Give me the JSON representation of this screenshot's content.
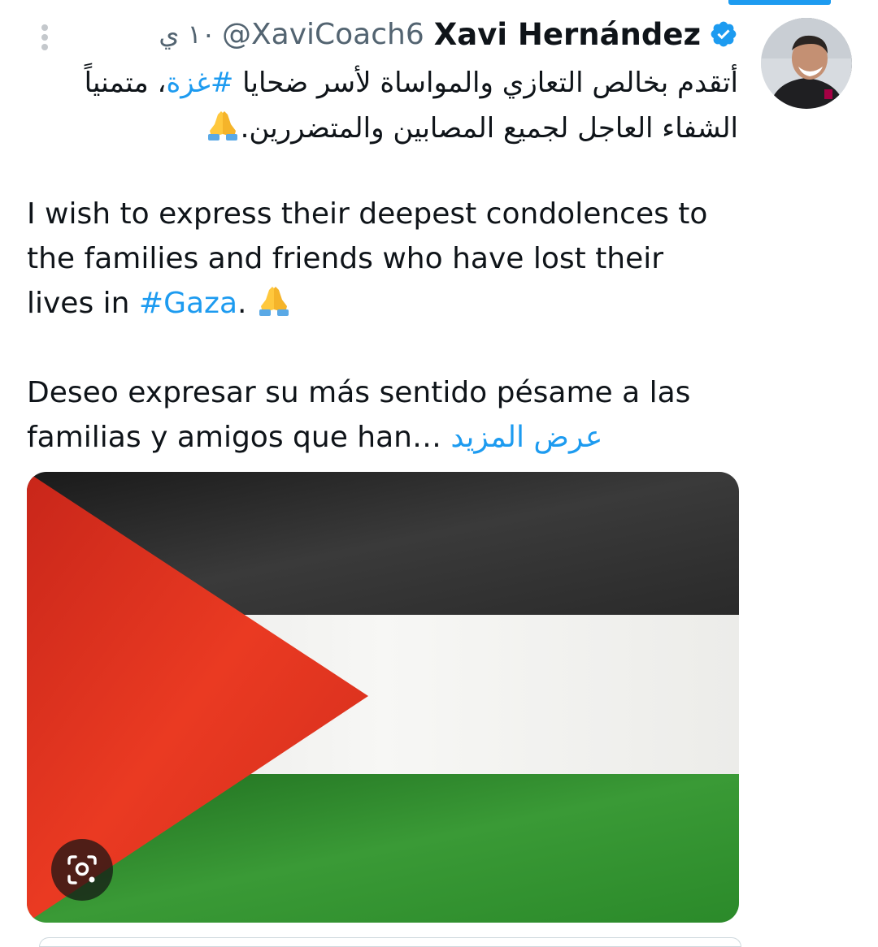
{
  "tweet": {
    "time": "١٠ ي",
    "handle": "@XaviCoach6",
    "display_name": "Xavi Hernández",
    "arabic": {
      "line1_before": "أتقدم بخالص التعازي والمواساة لأسر ضحايا ",
      "hashtag": "#غزة",
      "line1_after": "، متمنياً",
      "line2": "الشفاء العاجل لجميع المصابين والمتضررين."
    },
    "english": {
      "line1": "I wish to express their deepest condolences to",
      "line2": "the families and friends who have lost their",
      "line3_before": "lives in ",
      "hashtag": "#Gaza",
      "line3_after": ". "
    },
    "spanish": {
      "line1": "Deseo expresar su más sentido pésame a las",
      "line2": "familias y amigos que han… ",
      "show_more": "عرض المزيد"
    }
  },
  "icons": {
    "more": "more-vertical-icon",
    "verified": "verified-badge-icon",
    "emoji": "folded-hands-emoji",
    "lens": "image-search-lens-icon"
  },
  "media": {
    "type": "flag image",
    "colors": {
      "black": "#2a2a2a",
      "white": "#f2f2f0",
      "green": "#2e8a2c",
      "red": "#e2311e"
    }
  },
  "colors": {
    "accent": "#1d9bf0",
    "text": "#0f1419",
    "secondary": "#536471"
  }
}
